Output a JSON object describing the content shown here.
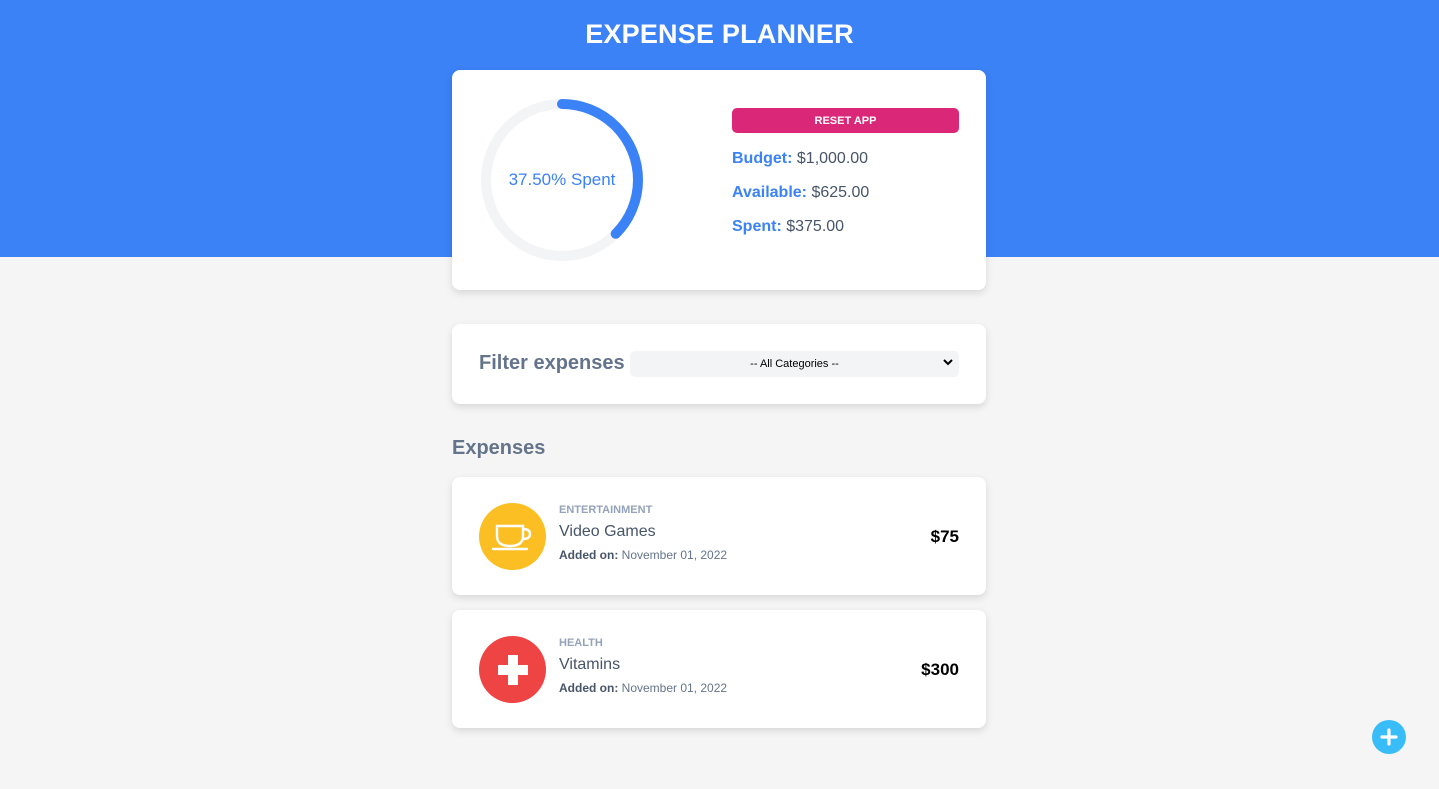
{
  "header": {
    "title": "EXPENSE PLANNER"
  },
  "budget": {
    "spent_percent": 37.5,
    "spent_label": "37.50% Spent",
    "reset_label": "RESET APP",
    "budget_key": "Budget:",
    "budget_value": "$1,000.00",
    "available_key": "Available:",
    "available_value": "$625.00",
    "spent_key": "Spent:",
    "spent_value": "$375.00"
  },
  "filter": {
    "label": "Filter expenses",
    "selected": "-- All Categories --"
  },
  "expenses": {
    "heading": "Expenses",
    "items": [
      {
        "category": "ENTERTAINMENT",
        "name": "Video Games",
        "date_key": "Added on:",
        "date": "November 01, 2022",
        "amount": "$75",
        "icon": "coffee-cup-icon",
        "icon_color": "#fbbf24"
      },
      {
        "category": "HEALTH",
        "name": "Vitamins",
        "date_key": "Added on:",
        "date": "November 01, 2022",
        "amount": "$300",
        "icon": "medical-cross-icon",
        "icon_color": "#ef4444"
      }
    ]
  },
  "colors": {
    "brand_blue": "#3b82f6",
    "reset_pink": "#db2777",
    "fab_cyan": "#38bdf8",
    "track_gray": "#f3f4f6"
  },
  "fab": {
    "icon": "plus-icon"
  }
}
